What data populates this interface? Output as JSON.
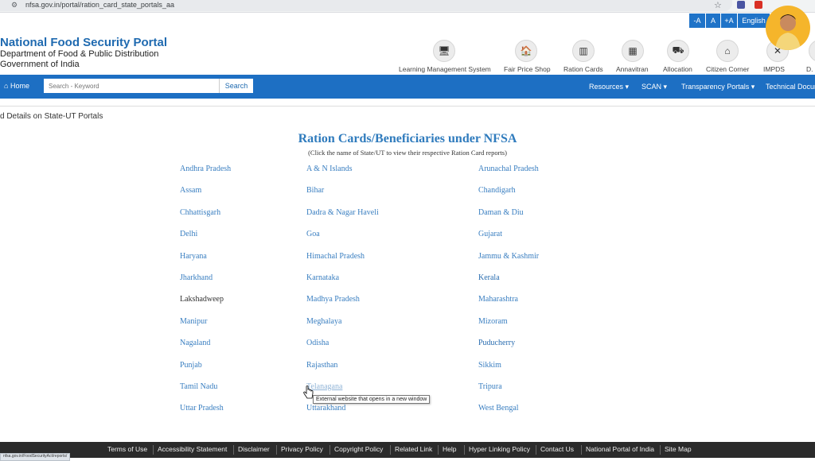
{
  "browser": {
    "url": "nfsa.gov.in/portal/ration_card_state_portals_aa",
    "status_url": "nfsa.gov.in/FoodSecurityAct/reports/"
  },
  "accessibility": {
    "decrease": "-A",
    "normal": "A",
    "increase": "+A",
    "language": "English"
  },
  "header": {
    "title": "National Food Security Portal",
    "dept": "Department of Food & Public Distribution",
    "gov": "Government of India"
  },
  "quick_links": [
    {
      "label": "Learning Management System",
      "icon": "monitor-icon"
    },
    {
      "label": "Fair Price Shop",
      "icon": "shop-icon"
    },
    {
      "label": "Ration Cards",
      "icon": "card-icon"
    },
    {
      "label": "Annavitran",
      "icon": "phone-icon"
    },
    {
      "label": "Allocation",
      "icon": "truck-icon"
    },
    {
      "label": "Citizen Corner",
      "icon": "home-icon"
    },
    {
      "label": "IMPDS",
      "icon": "arrows-icon"
    },
    {
      "label": "D.",
      "icon": "chevron-icon"
    }
  ],
  "nav": {
    "home": "Home",
    "search_placeholder": "Search - Keyword",
    "search_button": "Search",
    "items": [
      "Resources",
      "SCAN",
      "Transparency Portals",
      "Technical Docum"
    ]
  },
  "breadcrumb": "d Details on State-UT Portals",
  "main": {
    "title": "Ration Cards/Beneficiaries under NFSA",
    "subtitle": "(Click the name of State/UT to view their respective Ration Card reports)"
  },
  "states": {
    "col1": [
      "Andhra Pradesh",
      "Assam",
      "Chhattisgarh",
      "Delhi",
      "Haryana",
      "Jharkhand",
      "Lakshadweep",
      "Manipur",
      "Nagaland",
      "Punjab",
      "Tamil Nadu",
      "Uttar Pradesh"
    ],
    "col2": [
      "A & N Islands",
      "Bihar",
      "Dadra & Nagar Haveli",
      "Goa",
      "Himachal Pradesh",
      "Karnataka",
      "Madhya Pradesh",
      "Meghalaya",
      "Odisha",
      "Rajasthan",
      "Telanagana",
      "Uttarakhand"
    ],
    "col3": [
      "Arunachal Pradesh",
      "Chandigarh",
      "Daman & Diu",
      "Gujarat",
      "Jammu & Kashmir",
      "Kerala",
      "Maharashtra",
      "Mizoram",
      "Puducherry",
      "Sikkim",
      "Tripura",
      "West Bengal"
    ]
  },
  "tooltip": "External website that opens in a new window",
  "footer": [
    "Terms of Use",
    "Accessibility Statement",
    "Disclaimer",
    "Privacy Policy",
    "Copyright Policy",
    "Related Link",
    "Help",
    "Hyper Linking Policy",
    "Contact Us",
    "National Portal of India",
    "Site Map"
  ],
  "colors": {
    "primary": "#1d6fc3",
    "link": "#3a7fc1",
    "footer": "#2b2b2b"
  }
}
